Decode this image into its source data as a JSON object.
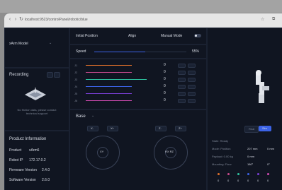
{
  "browser": {
    "url": "localhost:9523/controlPanel/robotic/blue"
  },
  "sidebar": {
    "model_select": "xArm Model",
    "recording": {
      "title": "Recording",
      "note": "No friction data, please contact technical support"
    },
    "product": {
      "title": "Product Information",
      "rows": [
        {
          "label": "Product",
          "value": "xArm6"
        },
        {
          "label": "Robot IP",
          "value": "172.17.0.2"
        },
        {
          "label": "Firmware Version",
          "value": "2.4.0"
        },
        {
          "label": "Software Version",
          "value": "2.6.0"
        }
      ]
    }
  },
  "top": {
    "initial_position": "Initial Position",
    "align": "Align",
    "manual_mode": "Manual Mode"
  },
  "speed": {
    "label": "Speed",
    "value_text": "55%",
    "fraction": 0.55
  },
  "joints": [
    {
      "label": "J1",
      "color": "#e0702a",
      "fraction": 0.72,
      "value": "0"
    },
    {
      "label": "J2",
      "color": "#c94a8c",
      "fraction": 0.72,
      "value": "0"
    },
    {
      "label": "J3",
      "color": "#2ec4a0",
      "fraction": 0.96,
      "value": "0"
    },
    {
      "label": "J4",
      "color": "#3c63e6",
      "fraction": 0.72,
      "value": "0"
    },
    {
      "label": "J5",
      "color": "#7a3fd6",
      "fraction": 0.72,
      "value": "0"
    },
    {
      "label": "J6",
      "color": "#d04ab0",
      "fraction": 0.72,
      "value": "0"
    }
  ],
  "base": {
    "label": "Base",
    "left_buttons": [
      "X-",
      "X+"
    ],
    "right_buttons": [
      "Z-",
      "Z+"
    ],
    "left_center": "XY",
    "right_center": "RX RZ"
  },
  "right": {
    "toggle": [
      "Real",
      "Sim"
    ],
    "state_rows": [
      {
        "label": "State: Ready",
        "value": ""
      },
      {
        "label": "Mode: Position",
        "value": "207 mm",
        "extra": "0 mm"
      },
      {
        "label": "Payload: 0.00 kg",
        "value": "0 mm",
        "extra": ""
      },
      {
        "label": "Mounting: Floor",
        "value": "180°",
        "extra": "0°"
      }
    ],
    "dot_labels": [
      "0",
      "0",
      "0",
      "0",
      "0",
      "0"
    ],
    "dot_colors": [
      "#e0702a",
      "#c94a8c",
      "#2ec4a0",
      "#3c63e6",
      "#7a3fd6",
      "#d04ab0"
    ]
  }
}
